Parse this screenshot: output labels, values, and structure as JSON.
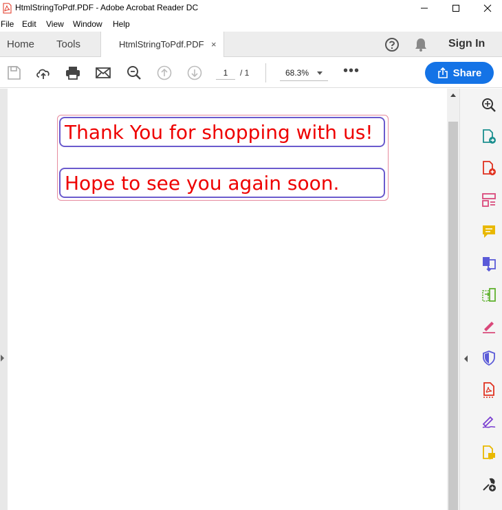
{
  "window": {
    "title": "HtmlStringToPdf.PDF - Adobe Acrobat Reader DC",
    "minimize_glyph": "—",
    "maximize_glyph": "☐",
    "close_glyph": "✕"
  },
  "menu": {
    "items": [
      {
        "label": "File"
      },
      {
        "label": "Edit"
      },
      {
        "label": "View"
      },
      {
        "label": "Window"
      },
      {
        "label": "Help"
      }
    ]
  },
  "tabs": {
    "home": "Home",
    "tools": "Tools",
    "document": "HtmlStringToPdf.PDF",
    "document_close": "×",
    "sign_in": "Sign In"
  },
  "toolbar": {
    "page_current": "1",
    "page_total": "/ 1",
    "zoom": "68.3%",
    "more": "•••",
    "share_label": "Share"
  },
  "document": {
    "line1": "Thank You for shopping with us!",
    "line2": "Hope to see you again soon."
  },
  "colors": {
    "accent": "#1473e6",
    "doc_text": "#e00000",
    "box_border": "#6a5acd",
    "outer_border": "#e6899d",
    "acrobat_red": "#e0301e"
  },
  "right_pane_tools": [
    {
      "name": "zoom-tool-icon"
    },
    {
      "name": "export-pdf-icon"
    },
    {
      "name": "create-pdf-icon"
    },
    {
      "name": "edit-pdf-icon"
    },
    {
      "name": "comment-icon"
    },
    {
      "name": "combine-files-icon"
    },
    {
      "name": "organize-pages-icon"
    },
    {
      "name": "fill-sign-icon"
    },
    {
      "name": "protect-icon"
    },
    {
      "name": "pdf-standards-icon"
    },
    {
      "name": "send-for-signature-icon"
    },
    {
      "name": "send-for-comments-icon"
    },
    {
      "name": "more-tools-icon"
    }
  ]
}
